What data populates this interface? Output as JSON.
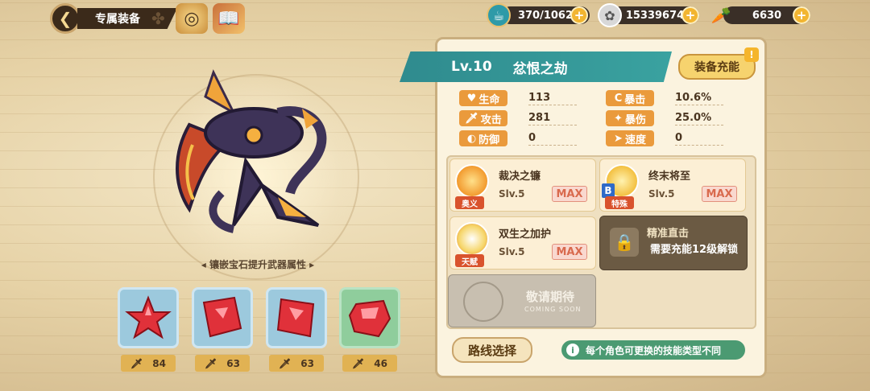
{
  "topbar": {
    "title": "专属装备",
    "resources": [
      {
        "icon": "stamina-icon",
        "value": "370/1062"
      },
      {
        "icon": "coin-icon",
        "value": "15339674"
      },
      {
        "icon": "carrot-icon",
        "value": "6630"
      }
    ]
  },
  "weapon": {
    "level": "Lv.10",
    "name": "忿恨之劫",
    "charge_label": "装备充能",
    "charge_badge": "!",
    "inlay_caption": "镶嵌宝石提升武器属性"
  },
  "stats": [
    {
      "label": "生命",
      "icon": "heart-icon",
      "value": "113"
    },
    {
      "label": "攻击",
      "icon": "sword-icon",
      "value": "281"
    },
    {
      "label": "防御",
      "icon": "shield-icon",
      "value": "0"
    },
    {
      "label": "暴击",
      "icon": "crit-icon",
      "value": "10.6%"
    },
    {
      "label": "暴伤",
      "icon": "crit-damage-icon",
      "value": "25.0%"
    },
    {
      "label": "速度",
      "icon": "boot-icon",
      "value": "0"
    }
  ],
  "gems": [
    {
      "stat_icon": "sword-icon",
      "value": "84",
      "frame": "#cfe6f2"
    },
    {
      "stat_icon": "sword-icon",
      "value": "63",
      "frame": "#cfe6f2"
    },
    {
      "stat_icon": "sword-icon",
      "value": "63",
      "frame": "#cfe6f2"
    },
    {
      "stat_icon": "sword-icon",
      "value": "46",
      "frame": "#b9e3c3"
    }
  ],
  "skills": [
    {
      "name": "裁决之镰",
      "tag": "奥义",
      "level": "Slv.5",
      "max": "MAX"
    },
    {
      "name": "终末将至",
      "tag": "特殊",
      "level": "Slv.5",
      "max": "MAX",
      "key": "B"
    },
    {
      "name": "双生之加护",
      "tag": "天赋",
      "level": "Slv.5",
      "max": "MAX"
    }
  ],
  "locked_skill": {
    "name": "精准直击",
    "desc": "需要充能12级解锁"
  },
  "coming_soon": {
    "title": "敬请期待",
    "sub": "COMING SOON"
  },
  "route_button": "路线选择",
  "tip": "每个角色可更换的技能类型不同",
  "colors": {
    "accent": "#2f8b8e",
    "stat_label": "#ea9a3c",
    "gold": "#f2b531"
  }
}
